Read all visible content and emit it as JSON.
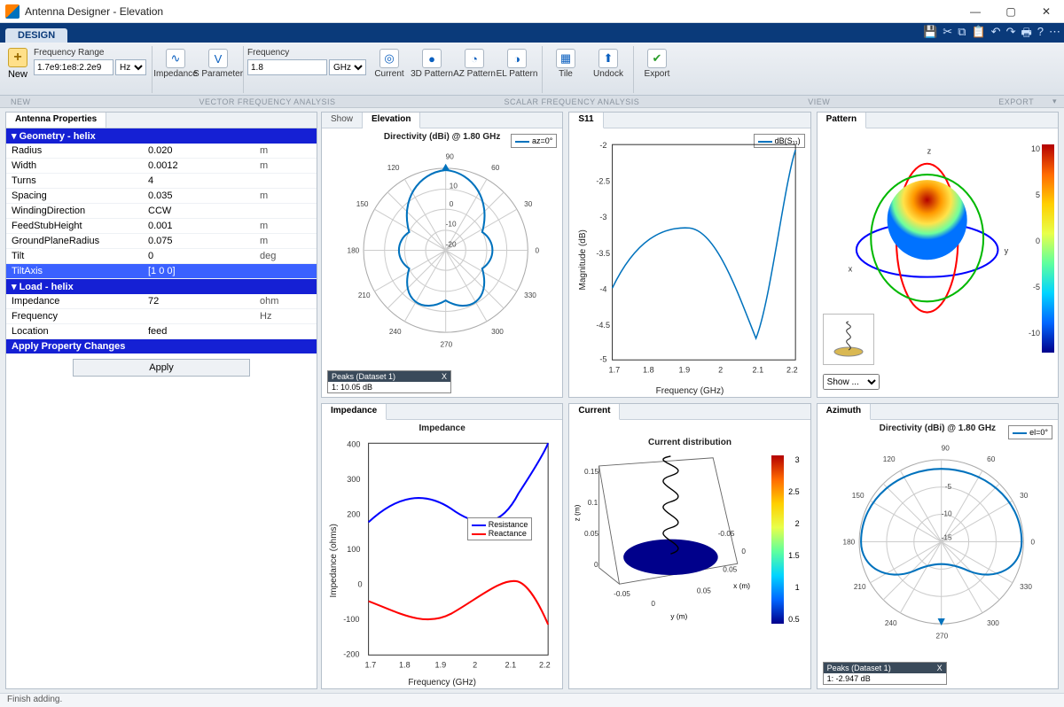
{
  "window": {
    "title": "Antenna Designer - Elevation"
  },
  "ribbon": {
    "tab": "DESIGN",
    "new": "New",
    "freq_range_label": "Frequency Range",
    "freq_range_value": "1.7e9:1e8:2.2e9",
    "freq_range_unit": "Hz",
    "freq_label": "Frequency",
    "freq_value": "1.8",
    "freq_unit": "GHz",
    "btn_impedance": "Impedance",
    "btn_sparam": "S Parameter",
    "btn_current": "Current",
    "btn_3dpattern": "3D Pattern",
    "btn_azpattern": "AZ Pattern",
    "btn_elpattern": "EL Pattern",
    "btn_tile": "Tile",
    "btn_undock": "Undock",
    "btn_export": "Export",
    "grp_new": "NEW",
    "grp_vfa": "VECTOR FREQUENCY ANALYSIS",
    "grp_sfa": "SCALAR FREQUENCY ANALYSIS",
    "grp_view": "VIEW",
    "grp_export": "EXPORT"
  },
  "props": {
    "tab": "Antenna Properties",
    "geom_hdr": "▾ Geometry - helix",
    "rows_geom": [
      {
        "name": "Radius",
        "val": "0.020",
        "unit": "m"
      },
      {
        "name": "Width",
        "val": "0.0012",
        "unit": "m"
      },
      {
        "name": "Turns",
        "val": "4",
        "unit": ""
      },
      {
        "name": "Spacing",
        "val": "0.035",
        "unit": "m"
      },
      {
        "name": "WindingDirection",
        "val": "CCW",
        "unit": ""
      },
      {
        "name": "FeedStubHeight",
        "val": "0.001",
        "unit": "m"
      },
      {
        "name": "GroundPlaneRadius",
        "val": "0.075",
        "unit": "m"
      },
      {
        "name": "Tilt",
        "val": "0",
        "unit": "deg"
      },
      {
        "name": "TiltAxis",
        "val": "[1 0 0]",
        "unit": "",
        "sel": true
      }
    ],
    "load_hdr": "▾ Load - helix",
    "rows_load": [
      {
        "name": "Impedance",
        "val": "72",
        "unit": "ohm"
      },
      {
        "name": "Frequency",
        "val": "",
        "unit": "Hz"
      },
      {
        "name": "Location",
        "val": "feed",
        "unit": ""
      }
    ],
    "apply_hdr": "Apply Property Changes",
    "apply_btn": "Apply"
  },
  "panels": {
    "elev": {
      "tabs": [
        "Show",
        "Elevation"
      ],
      "title": "Directivity (dBi) @ 1.80 GHz",
      "legend": "az=0°",
      "peaks_hdr": "Peaks (Dataset 1)",
      "peaks_val": "1: 10.05 dB"
    },
    "s11": {
      "tab": "S11",
      "legend": "dB(S₁₁)",
      "xlabel": "Frequency (GHz)",
      "ylabel": "Magnitude (dB)"
    },
    "pat": {
      "tab": "Pattern",
      "show": "Show ..."
    },
    "imp": {
      "tab": "Impedance",
      "title": "Impedance",
      "xlabel": "Frequency (GHz)",
      "ylabel": "Impedance (ohms)",
      "leg1": "Resistance",
      "leg2": "Reactance"
    },
    "cur": {
      "tab": "Current",
      "title": "Current distribution",
      "xlabel": "x (m)",
      "ylabel": "y (m)",
      "zlabel": "z (m)"
    },
    "az": {
      "tab": "Azimuth",
      "title": "Directivity (dBi) @ 1.80 GHz",
      "legend": "el=0°",
      "peaks_hdr": "Peaks (Dataset 1)",
      "peaks_val": "1: -2.947 dB"
    }
  },
  "status": "Finish adding.",
  "chart_data": [
    {
      "panel": "s11",
      "type": "line",
      "x": [
        1.7,
        1.8,
        1.9,
        2.0,
        2.1,
        2.2
      ],
      "y": [
        -4.0,
        -3.1,
        -3.05,
        -3.2,
        -4.4,
        -2.1
      ],
      "xlabel": "Frequency (GHz)",
      "ylabel": "Magnitude (dB)",
      "ylim": [
        -5,
        -2
      ],
      "series": [
        {
          "name": "dB(S11)"
        }
      ]
    },
    {
      "panel": "impedance",
      "type": "line",
      "x": [
        1.7,
        1.8,
        1.9,
        2.0,
        2.1,
        2.2
      ],
      "xlabel": "Frequency (GHz)",
      "ylabel": "Impedance (ohms)",
      "ylim": [
        -200,
        400
      ],
      "series": [
        {
          "name": "Resistance",
          "color": "#0000ff",
          "values": [
            210,
            270,
            230,
            175,
            210,
            360
          ]
        },
        {
          "name": "Reactance",
          "color": "#ff0000",
          "values": [
            -35,
            -55,
            -95,
            -50,
            30,
            -90
          ]
        }
      ],
      "title": "Impedance"
    },
    {
      "panel": "elevation",
      "type": "polar",
      "title": "Directivity (dBi) @ 1.80 GHz",
      "legend": "az=0°",
      "angles_deg": [
        0,
        30,
        60,
        90,
        120,
        150,
        180,
        210,
        240,
        270,
        300,
        330
      ],
      "r_ticks": [
        -20,
        -10,
        0,
        10
      ],
      "peak_db": 10.05
    },
    {
      "panel": "azimuth",
      "type": "polar",
      "title": "Directivity (dBi) @ 1.80 GHz",
      "legend": "el=0°",
      "angles_deg": [
        0,
        30,
        60,
        90,
        120,
        150,
        180,
        210,
        240,
        270,
        300,
        330
      ],
      "r_ticks": [
        -15,
        -10,
        -5
      ],
      "peak_db": -2.947
    },
    {
      "panel": "pattern3d",
      "type": "heatmap",
      "colorbar_range": [
        -10,
        10
      ]
    },
    {
      "panel": "current",
      "type": "heatmap",
      "title": "Current distribution",
      "x_range": [
        -0.05,
        0.05
      ],
      "y_range": [
        -0.05,
        0.05
      ],
      "z_range": [
        0,
        0.15
      ],
      "colorbar_range": [
        0.5,
        3
      ]
    }
  ]
}
